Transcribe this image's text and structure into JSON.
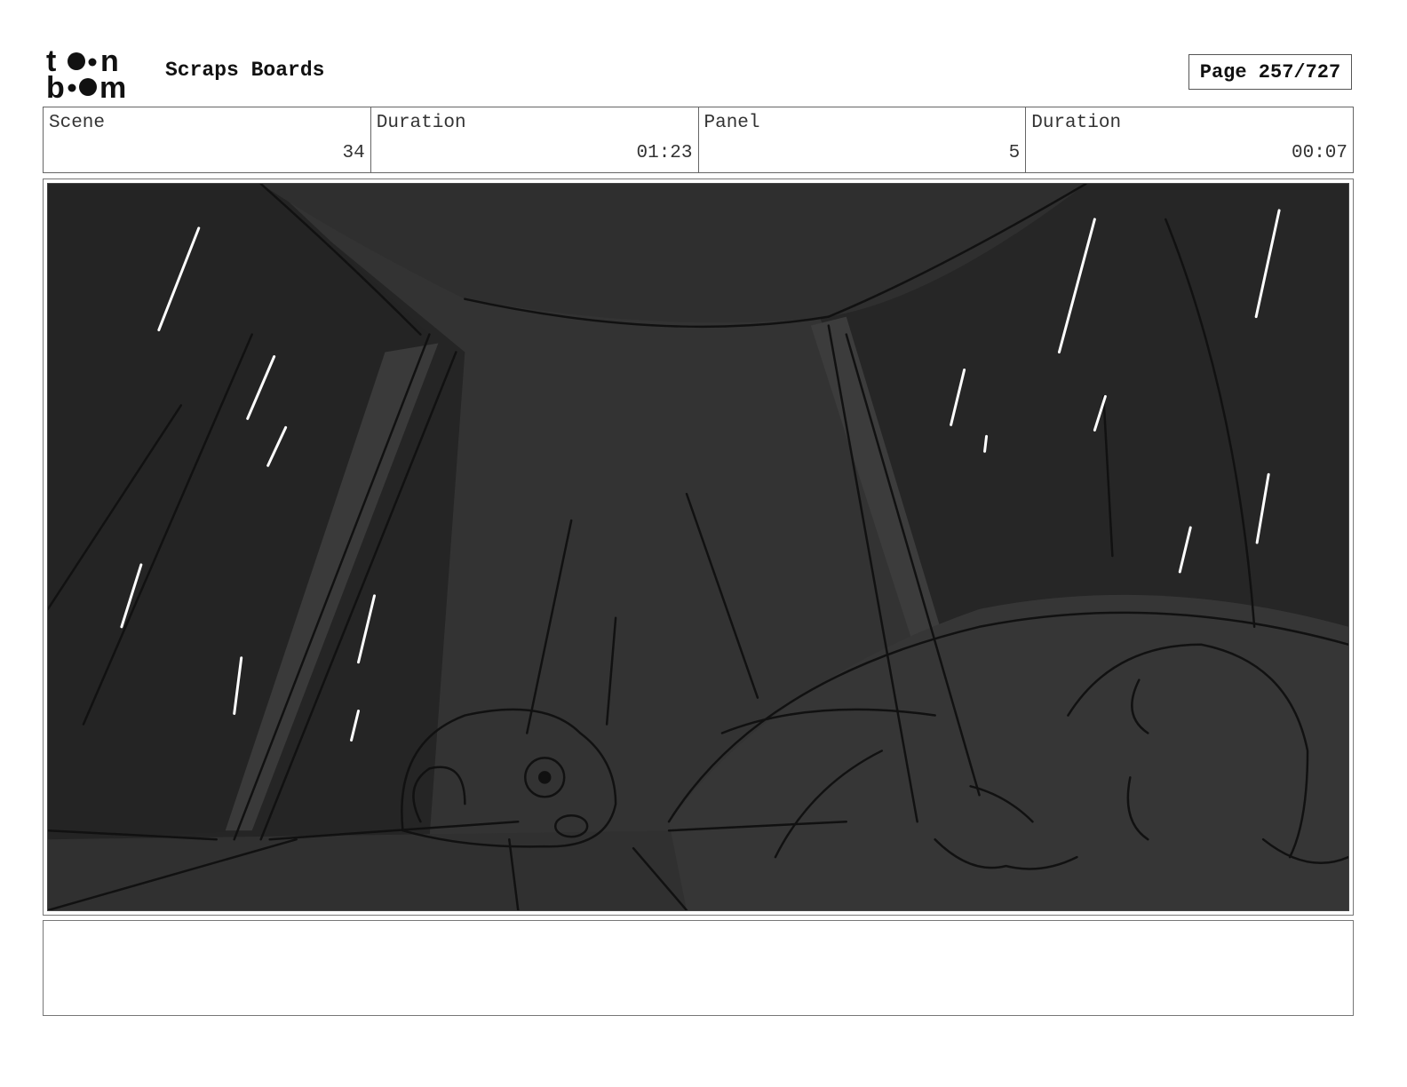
{
  "header": {
    "logo_alt": "toon boom",
    "title": "Scraps Boards",
    "page_label": "Page 257/727"
  },
  "info": {
    "scene_label": "Scene",
    "scene_value": "34",
    "scene_duration_label": "Duration",
    "scene_duration_value": "01:23",
    "panel_label": "Panel",
    "panel_value": "5",
    "panel_duration_label": "Duration",
    "panel_duration_value": "00:07"
  },
  "notes": {
    "text": ""
  }
}
